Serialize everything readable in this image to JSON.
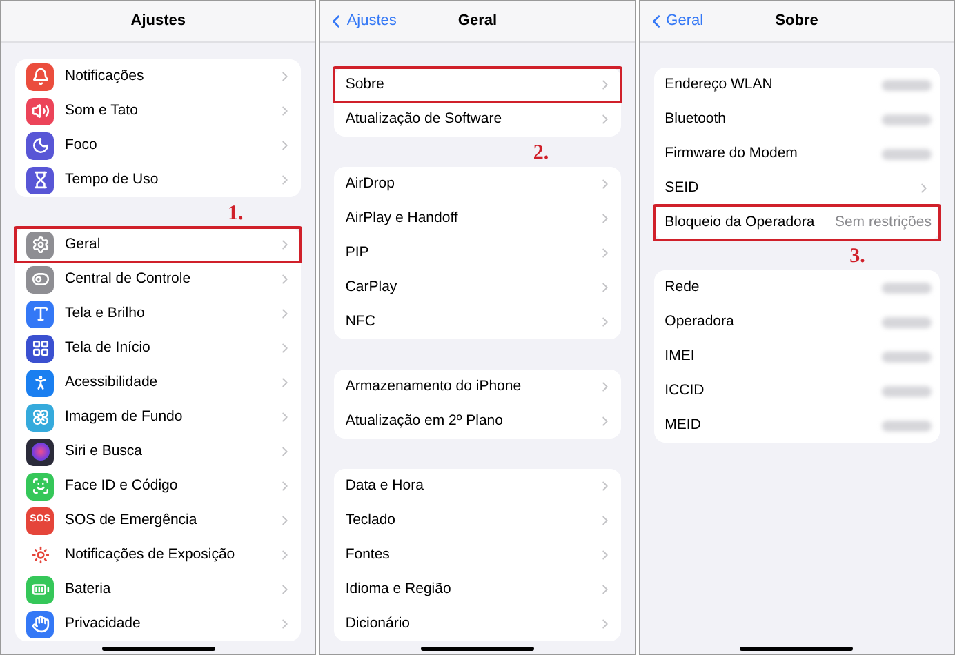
{
  "panels": [
    {
      "title": "Ajustes",
      "annotation": "1.",
      "groups": [
        [
          {
            "label": "Notificações",
            "kind": "bell",
            "color": "#eb4d3d",
            "highlighted": false,
            "chevron": true
          },
          {
            "label": "Som e Tato",
            "kind": "sound",
            "color": "#ec4459",
            "highlighted": false,
            "chevron": true
          },
          {
            "label": "Foco",
            "kind": "moon",
            "color": "#5856d6",
            "highlighted": false,
            "chevron": true
          },
          {
            "label": "Tempo de Uso",
            "kind": "hourglass",
            "color": "#5856d6",
            "highlighted": false,
            "chevron": true
          }
        ],
        [
          {
            "label": "Geral",
            "kind": "gear",
            "color": "#8e8e93",
            "highlighted": true,
            "chevron": true
          },
          {
            "label": "Central de Controle",
            "kind": "toggles",
            "color": "#8e8e93",
            "highlighted": false,
            "chevron": true
          },
          {
            "label": "Tela e Brilho",
            "kind": "textsize",
            "color": "#3478f6",
            "highlighted": false,
            "chevron": true
          },
          {
            "label": "Tela de Início",
            "kind": "grid",
            "color": "#3a50d0",
            "highlighted": false,
            "chevron": true
          },
          {
            "label": "Acessibilidade",
            "kind": "person",
            "color": "#1a7ff0",
            "highlighted": false,
            "chevron": true
          },
          {
            "label": "Imagem de Fundo",
            "kind": "flower",
            "color": "#35aadc",
            "highlighted": false,
            "chevron": true
          },
          {
            "label": "Siri e Busca",
            "kind": "orb",
            "color": "#2b2b3a",
            "highlighted": false,
            "chevron": true
          },
          {
            "label": "Face ID e Código",
            "kind": "face",
            "color": "#35c759",
            "highlighted": false,
            "chevron": true
          },
          {
            "label": "SOS de Emergência",
            "kind": "sos",
            "icon_text": "SOS",
            "color": "#e5453a",
            "highlighted": false,
            "chevron": true
          },
          {
            "label": "Notificações de Exposição",
            "kind": "exposure",
            "color": "#ffffff",
            "highlighted": false,
            "chevron": true
          },
          {
            "label": "Bateria",
            "kind": "battery",
            "color": "#35c759",
            "highlighted": false,
            "chevron": true
          },
          {
            "label": "Privacidade",
            "kind": "hand",
            "color": "#3478f6",
            "highlighted": false,
            "chevron": true
          }
        ]
      ]
    },
    {
      "back": "Ajustes",
      "title": "Geral",
      "annotation": "2.",
      "groups": [
        [
          {
            "label": "Sobre",
            "highlighted": true,
            "chevron": true
          },
          {
            "label": "Atualização de Software",
            "highlighted": false,
            "chevron": true
          }
        ],
        [
          {
            "label": "AirDrop",
            "highlighted": false,
            "chevron": true
          },
          {
            "label": "AirPlay e Handoff",
            "highlighted": false,
            "chevron": true
          },
          {
            "label": "PIP",
            "highlighted": false,
            "chevron": true
          },
          {
            "label": "CarPlay",
            "highlighted": false,
            "chevron": true
          },
          {
            "label": "NFC",
            "highlighted": false,
            "chevron": true
          }
        ],
        [
          {
            "label": "Armazenamento do iPhone",
            "highlighted": false,
            "chevron": true
          },
          {
            "label": "Atualização em 2º Plano",
            "highlighted": false,
            "chevron": true
          }
        ],
        [
          {
            "label": "Data e Hora",
            "highlighted": false,
            "chevron": true
          },
          {
            "label": "Teclado",
            "highlighted": false,
            "chevron": true
          },
          {
            "label": "Fontes",
            "highlighted": false,
            "chevron": true
          },
          {
            "label": "Idioma e Região",
            "highlighted": false,
            "chevron": true
          },
          {
            "label": "Dicionário",
            "highlighted": false,
            "chevron": true
          }
        ]
      ]
    },
    {
      "back": "Geral",
      "title": "Sobre",
      "annotation": "3.",
      "groups": [
        [
          {
            "label": "Endereço WLAN",
            "blurred": true,
            "highlighted": false,
            "chevron": false
          },
          {
            "label": "Bluetooth",
            "blurred": true,
            "highlighted": false,
            "chevron": false
          },
          {
            "label": "Firmware do Modem",
            "blurred": true,
            "highlighted": false,
            "chevron": false
          },
          {
            "label": "SEID",
            "highlighted": false,
            "chevron": true
          },
          {
            "label": "Bloqueio da Operadora",
            "value": "Sem restrições",
            "highlighted": true,
            "chevron": false
          }
        ],
        [
          {
            "label": "Rede",
            "blurred": true,
            "highlighted": false,
            "chevron": false
          },
          {
            "label": "Operadora",
            "blurred": true,
            "highlighted": false,
            "chevron": false
          },
          {
            "label": "IMEI",
            "blurred": true,
            "highlighted": false,
            "chevron": false
          },
          {
            "label": "ICCID",
            "blurred": true,
            "highlighted": false,
            "chevron": false
          },
          {
            "label": "MEID",
            "blurred": true,
            "highlighted": false,
            "chevron": false
          }
        ]
      ]
    }
  ]
}
